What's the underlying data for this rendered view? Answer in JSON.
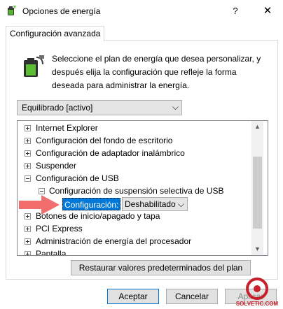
{
  "window": {
    "title": "Opciones de energía",
    "help_label": "?",
    "close_label": "✕",
    "app_icon": "power-options-icon"
  },
  "tabs": [
    {
      "label": "Configuración avanzada",
      "active": true
    }
  ],
  "description": {
    "line1": "Seleccione el plan de energía que desea personalizar, y",
    "line2": "después elija la configuración que refleje la forma",
    "line3": "deseada para administrar la energía."
  },
  "plan_select": {
    "value": "Equilibrado [activo]",
    "chevron": "⌵"
  },
  "tree": {
    "items": [
      {
        "label": "Internet Explorer",
        "state": "collapsed"
      },
      {
        "label": "Configuración del fondo de escritorio",
        "state": "collapsed"
      },
      {
        "label": "Configuración de adaptador inalámbrico",
        "state": "collapsed"
      },
      {
        "label": "Suspender",
        "state": "collapsed"
      },
      {
        "label": "Configuración de USB",
        "state": "expanded"
      },
      {
        "label": "Configuración de suspensión selectiva de USB",
        "state": "expanded"
      },
      {
        "label": "Botones de inicio/apagado y tapa",
        "state": "collapsed"
      },
      {
        "label": "PCI Express",
        "state": "collapsed"
      },
      {
        "label": "Administración de energía del procesador",
        "state": "collapsed"
      },
      {
        "label": "Pantalla",
        "state": "collapsed"
      }
    ],
    "setting": {
      "label": "Configuración:",
      "value": "Deshabilitado",
      "chevron": "⌵"
    }
  },
  "scrollbar": {
    "up_arrow": "▲",
    "down_arrow": "▼"
  },
  "buttons": {
    "restore": "Restaurar valores predeterminados del plan",
    "ok": "Aceptar",
    "cancel": "Cancelar",
    "apply": "Aplicar"
  },
  "watermark": {
    "text": "SOLVETIC.COM",
    "icon": "solvetic-logo-icon"
  },
  "colors": {
    "selection": "#0078d7",
    "arrow": "#f26d6d",
    "logo": "#c8202b"
  }
}
